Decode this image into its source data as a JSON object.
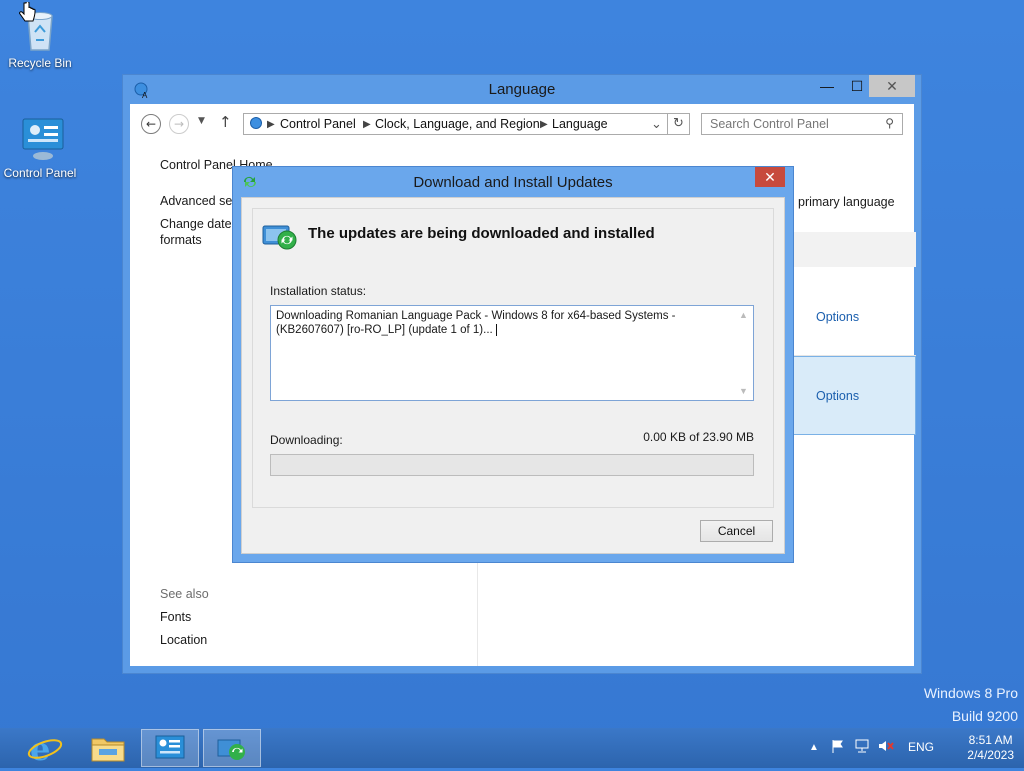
{
  "desktop": {
    "icons": [
      {
        "label": "Recycle Bin",
        "icon": "recycle-bin-icon"
      },
      {
        "label": "Control Panel",
        "icon": "control-panel-icon"
      }
    ],
    "watermark_line1": "Windows 8 Pro",
    "watermark_line2": "Build 9200"
  },
  "window": {
    "title": "Language",
    "minimize": "—",
    "maximize": "☐",
    "close": "✕",
    "breadcrumbs": [
      "Control Panel",
      "Clock, Language, and Region",
      "Language"
    ],
    "search_placeholder": "Search Control Panel",
    "sidebar": {
      "home": "Control Panel Home",
      "advanced": "Advanced sett",
      "change_date_1": "Change date,",
      "change_date_2": "formats",
      "see_also": "See also",
      "fonts": "Fonts",
      "location": "Location"
    },
    "main": {
      "partial_text": "primary language",
      "options_1": "Options",
      "options_2": "Options"
    }
  },
  "dialog": {
    "title": "Download and Install Updates",
    "close": "✕",
    "heading": "The updates are being downloaded and installed",
    "status_label": "Installation status:",
    "status_text": "Downloading Romanian Language Pack - Windows 8 for x64-based Systems - (KB2607607) [ro-RO_LP] (update 1 of 1)...",
    "downloading_label": "Downloading:",
    "size_text": "0.00 KB of 23.90 MB",
    "progress": 0,
    "cancel": "Cancel"
  },
  "taskbar": {
    "items": [
      "internet-explorer-icon",
      "file-explorer-icon",
      "control-panel-icon",
      "windows-update-icon"
    ],
    "lang": "ENG",
    "time": "8:51 AM",
    "date": "2/4/2023"
  }
}
